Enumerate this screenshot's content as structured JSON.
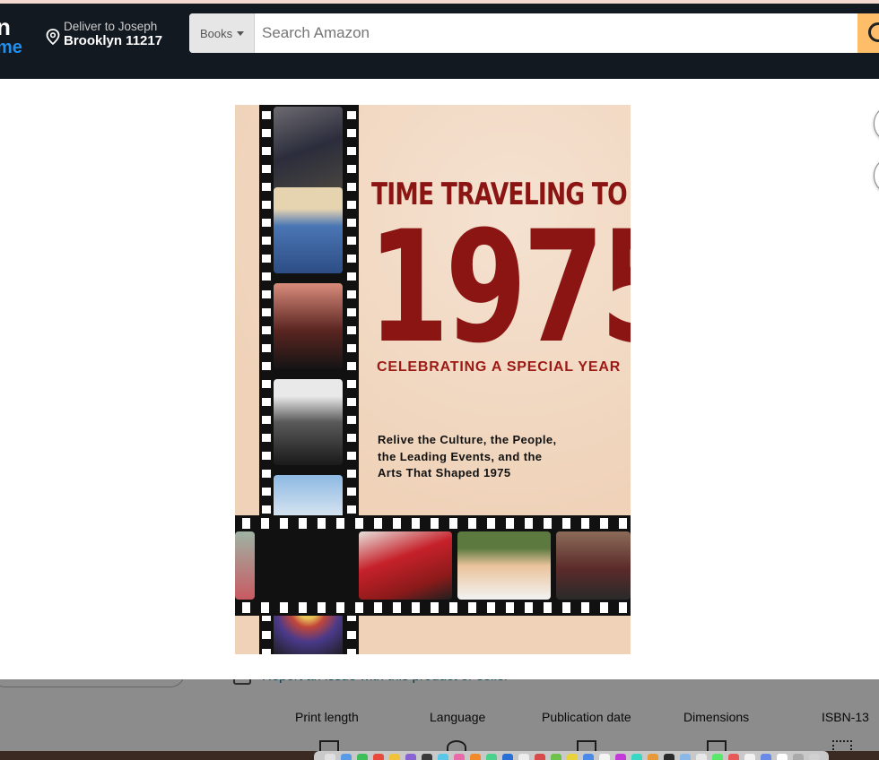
{
  "header": {
    "logo_fragment_top": "n",
    "logo_fragment_bottom": "me",
    "deliver_line1": "Deliver to Joseph",
    "deliver_line2": "Brooklyn 11217",
    "search_category": "Books",
    "search_placeholder": "Search Amazon"
  },
  "book_cover": {
    "title_line": "TIME TRAVELING TO",
    "year": "1975",
    "subtitle": "CELEBRATING A SPECIAL YEAR",
    "blurb_line1": "Relive the Culture, the People,",
    "blurb_line2": "the Leading Events, and the",
    "blurb_line3": "Arts That Shaped 1975",
    "title_color": "#8b1512",
    "paper_color": "#efd2b8"
  },
  "behind_modal": {
    "report_link": "Report an issue with this product or seller",
    "details": [
      "Print length",
      "Language",
      "Publication date",
      "Dimensions",
      "ISBN-13"
    ]
  },
  "colors": {
    "header_bg": "#131921",
    "search_button": "#febd69",
    "link": "#007185"
  }
}
